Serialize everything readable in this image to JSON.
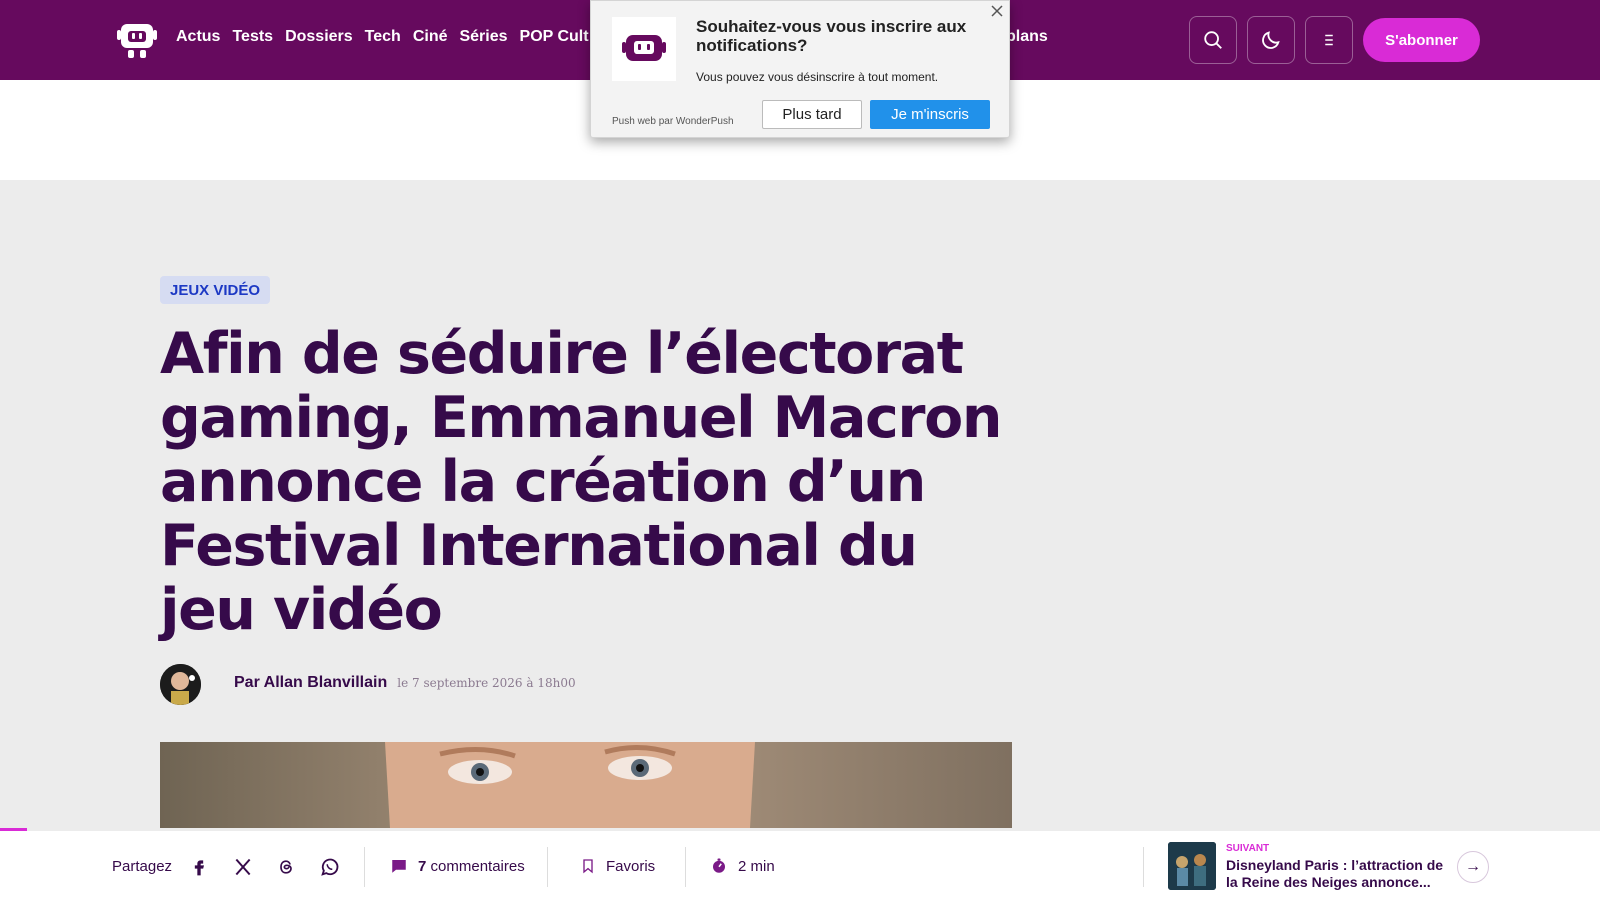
{
  "header": {
    "nav": [
      "Actus",
      "Tests",
      "Dossiers",
      "Tech",
      "Ciné",
      "Séries",
      "POP Cult"
    ],
    "nav_overflow": "plans",
    "search_icon": "search-icon",
    "theme_icon": "moon-icon",
    "menu_icon": "menu-icon",
    "subscribe_label": "S'abonner"
  },
  "notification_popup": {
    "title": "Souhaitez-vous vous inscrire aux notifications?",
    "subtitle": "Vous pouvez vous désinscrire à tout moment.",
    "powered_by": "Push web par WonderPush",
    "later_label": "Plus tard",
    "subscribe_label": "Je m'inscris"
  },
  "article": {
    "category": "JEUX VIDÉO",
    "title": "Afin de séduire l’électorat gaming, Emmanuel Macron annonce la création d’un Festival International du jeu vidéo",
    "author": "Par Allan Blanvillain",
    "date": "le 7 septembre 2026 à 18h00"
  },
  "bottom_bar": {
    "share_label": "Partagez",
    "share_icons": [
      "facebook-icon",
      "x-icon",
      "threads-icon",
      "whatsapp-icon"
    ],
    "comments_count": "7",
    "comments_label": "commentaires",
    "favorites_label": "Favoris",
    "read_time": "2 min",
    "next_label": "SUIVANT",
    "next_title": "Disneyland Paris : l’attraction de la Reine des Neiges annonce..."
  },
  "colors": {
    "header_bg": "#660a5e",
    "accent": "#d92bd6",
    "title": "#360a4a",
    "tag_bg": "#d6dcf2",
    "tag_text": "#1d39c4",
    "popup_button": "#2191ea"
  }
}
